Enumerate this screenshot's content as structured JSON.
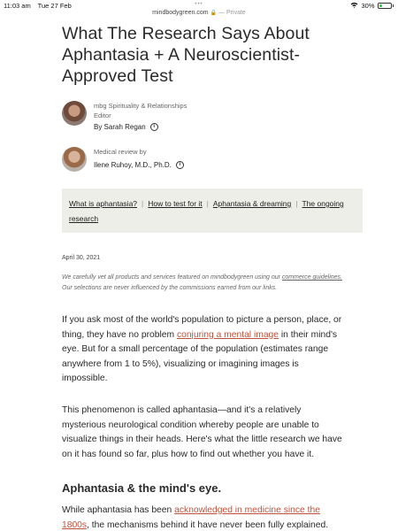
{
  "status_bar": {
    "time": "11:03 am",
    "date": "Tue 27 Feb",
    "battery": "30%",
    "battery_level": 0.3
  },
  "browser": {
    "domain": "mindbodygreen.com",
    "mode": "— Private",
    "dots": "•••"
  },
  "article": {
    "headline": "What The Research Says About Aphantasia + A Neuroscientist-Approved Test",
    "author": {
      "role": "mbg Spirituality & Relationships",
      "title": "Editor",
      "byline": "By Sarah Regan"
    },
    "reviewer": {
      "label": "Medical review by",
      "name": "Ilene Ruhoy, M.D., Ph.D."
    },
    "toc": [
      {
        "label": "What is aphantasia?"
      },
      {
        "label": "How to test for it"
      },
      {
        "label": "Aphantasia & dreaming"
      },
      {
        "label": "The ongoing research"
      }
    ],
    "date": "April 30, 2021",
    "disclaimer": {
      "before": "We carefully vet all products and services featured on mindbodygreen using our ",
      "link": "commerce guidelines.",
      "after": " Our selections are never influenced by the commissions earned from our links."
    },
    "p1": {
      "before": "If you ask most of the world's population to picture a person, place, or thing, they have no problem ",
      "link": "conjuring a mental image",
      "after": " in their mind's eye. But for a small percentage of the population (estimates range anywhere from 1 to 5%), visualizing or imagining images is impossible."
    },
    "p2": "This phenomenon is called aphantasia—and it's a relatively mysterious neurological condition whereby people are unable to visualize things in their heads. Here's what the little research we have on it has found so far, plus how to find out whether you have it.",
    "subhead": "Aphantasia & the mind's eye.",
    "p3": {
      "before": "While aphantasia has been ",
      "link": "acknowledged in medicine since the 1800s",
      "after": ", the mechanisms behind it have never been fully explained."
    }
  }
}
